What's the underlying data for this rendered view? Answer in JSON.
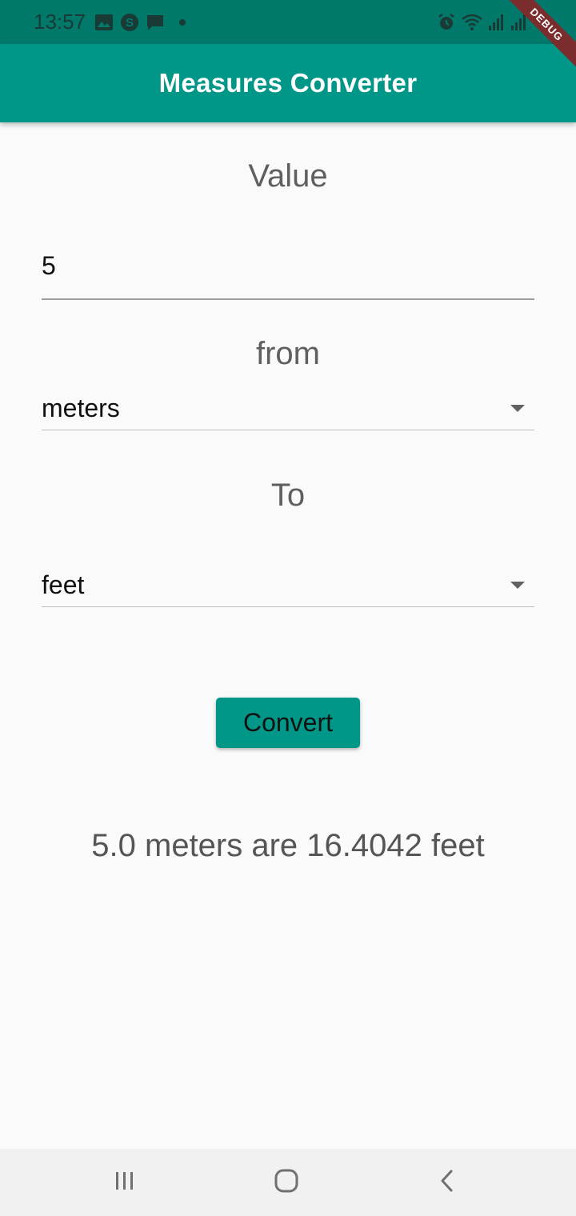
{
  "status_bar": {
    "time": "13:57",
    "left_icons": [
      "image-icon",
      "s-app-icon",
      "message-icon",
      "notification-dot"
    ],
    "right_icons": [
      "alarm-icon",
      "wifi-icon",
      "signal-icon",
      "signal-icon"
    ]
  },
  "debug_banner": "DEBUG",
  "app_bar": {
    "title": "Measures Converter",
    "color": "#009688"
  },
  "form": {
    "value_label": "Value",
    "value_input": "5",
    "from_label": "from",
    "from_selected": "meters",
    "to_label": "To",
    "to_selected": "feet",
    "convert_label": "Convert"
  },
  "result": "5.0 meters are 16.4042 feet",
  "nav_bar": {
    "buttons": [
      "recent-apps-icon",
      "home-icon",
      "back-icon"
    ]
  }
}
